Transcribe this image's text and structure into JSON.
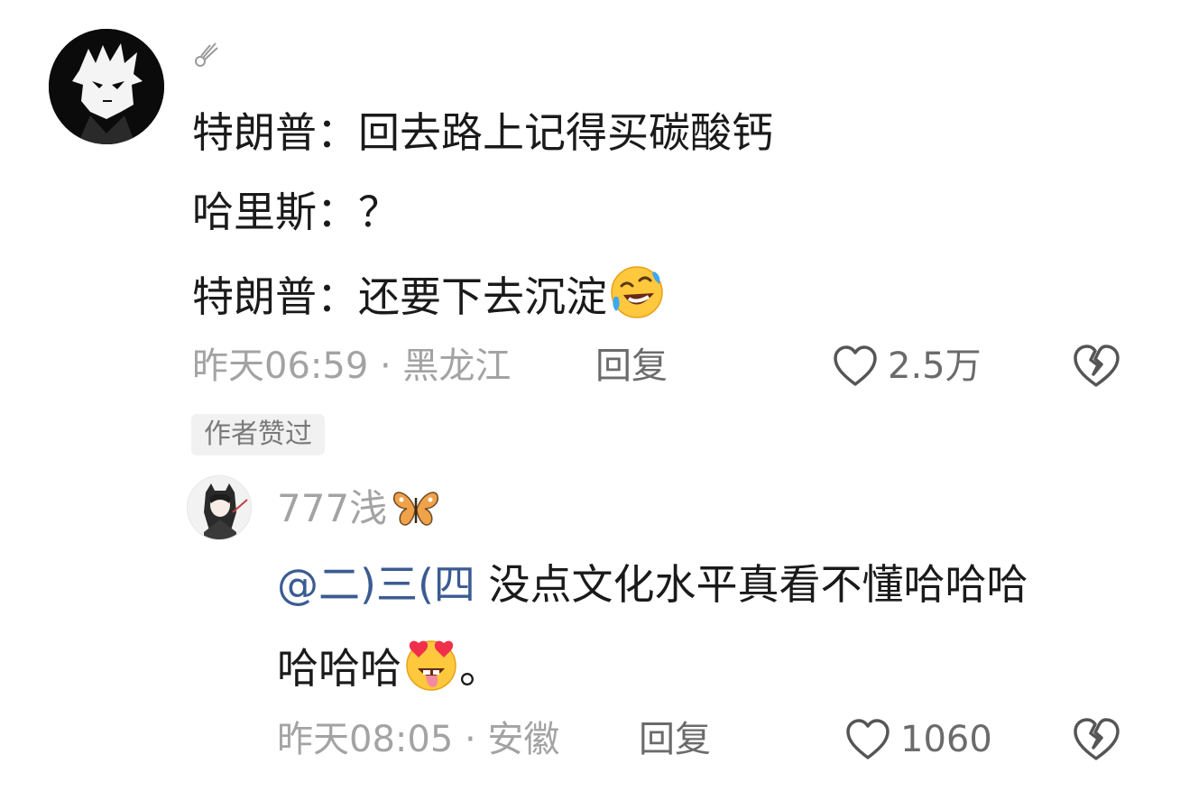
{
  "comment": {
    "avatar_icon": "anime-avatar-dark",
    "username_icon": "feather-icon",
    "lines": [
      "特朗普：回去路上记得买碳酸钙",
      "哈里斯：？",
      "特朗普：还要下去沉淀"
    ],
    "line3_emoji": "rolling-laughing-emoji",
    "meta": "昨天06:59 · 黑龙江",
    "reply_label": "回复",
    "like_count": "2.5万",
    "author_badge": "作者赞过"
  },
  "reply": {
    "avatar_icon": "anime-avatar-light",
    "username": "777浅",
    "username_decoration": "butterfly-icon",
    "mention": "@二)三(四",
    "text_line1": " 没点文化水平真看不懂哈哈哈",
    "text_line2": "哈哈哈",
    "text_line2_emoji": "heart-eyes-tongue-emoji",
    "text_line2_end": "。",
    "meta": "昨天08:05 · 安徽",
    "reply_label": "回复",
    "like_count": "1060"
  },
  "colors": {
    "text": "#1a1a1a",
    "meta": "#a3a3a3",
    "mention": "#3b5b92",
    "badge_bg": "#f1f1f1"
  }
}
